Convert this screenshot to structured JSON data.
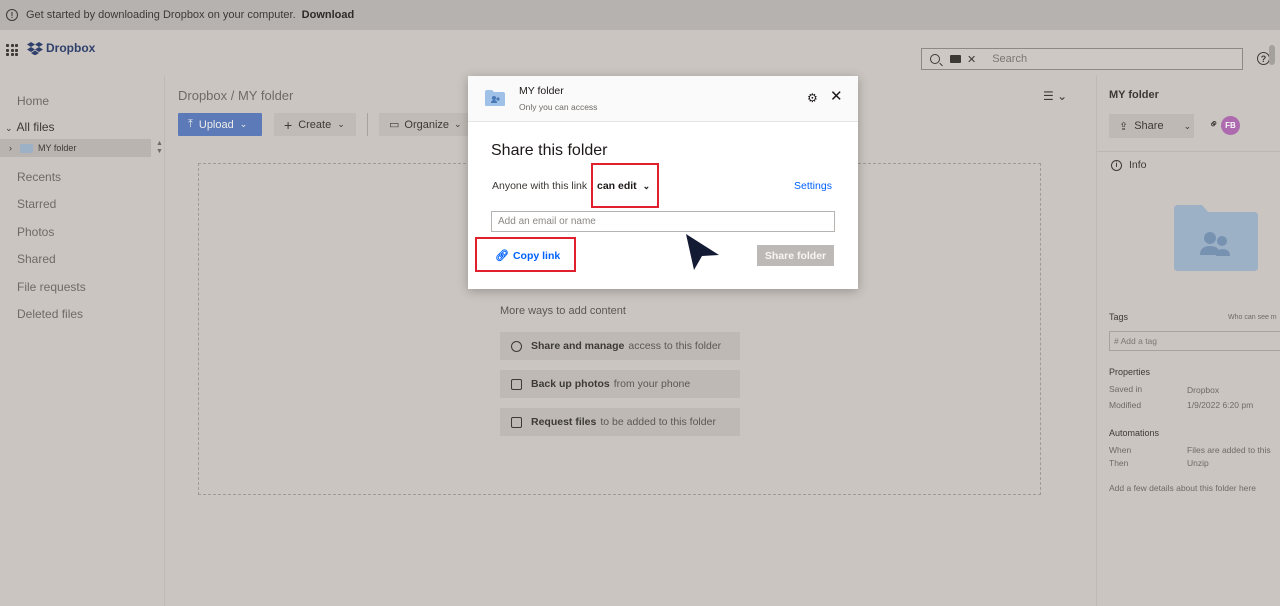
{
  "banner": {
    "message": "Get started by downloading Dropbox on your computer.",
    "link": "Download"
  },
  "header": {
    "logo": "Dropbox",
    "search_placeholder": "Search"
  },
  "sidebar": {
    "items": [
      {
        "label": "Home"
      },
      {
        "label": "All files"
      },
      {
        "label": "Recents"
      },
      {
        "label": "Starred"
      },
      {
        "label": "Photos"
      },
      {
        "label": "Shared"
      },
      {
        "label": "File requests"
      },
      {
        "label": "Deleted files"
      }
    ],
    "tree_folder": "MY folder"
  },
  "main": {
    "breadcrumb": "Dropbox / MY folder",
    "upload_label": "Upload",
    "create_label": "Create",
    "organize_label": "Organize",
    "more_ways": "More ways to add content",
    "actions": [
      {
        "strong": "Share and manage",
        "rest": "access to this folder"
      },
      {
        "strong": "Back up photos",
        "rest": "from your phone"
      },
      {
        "strong": "Request files",
        "rest": "to be added to this folder"
      }
    ]
  },
  "right_panel": {
    "title": "MY folder",
    "share_label": "Share",
    "avatar_initials": "FB",
    "info_label": "Info",
    "tags_label": "Tags",
    "who_can_see": "Who can see m",
    "tag_placeholder": "# Add a tag",
    "properties_label": "Properties",
    "saved_in_label": "Saved in",
    "saved_in_value": "Dropbox",
    "modified_label": "Modified",
    "modified_value": "1/9/2022 6:20 pm",
    "automations_label": "Automations",
    "when_label": "When",
    "when_value": "Files are added to this",
    "then_label": "Then",
    "then_value": "Unzip",
    "add_details": "Add a few details about this folder here"
  },
  "modal": {
    "folder_name": "MY folder",
    "access_note": "Only you can access",
    "heading": "Share this folder",
    "anyone_text": "Anyone with this link",
    "permission": "can edit",
    "settings_label": "Settings",
    "email_placeholder": "Add an email or name",
    "copy_link_label": "Copy link",
    "share_button_label": "Share folder"
  },
  "colors": {
    "accent_blue": "#0061fe",
    "highlight_red": "#e0202c"
  }
}
